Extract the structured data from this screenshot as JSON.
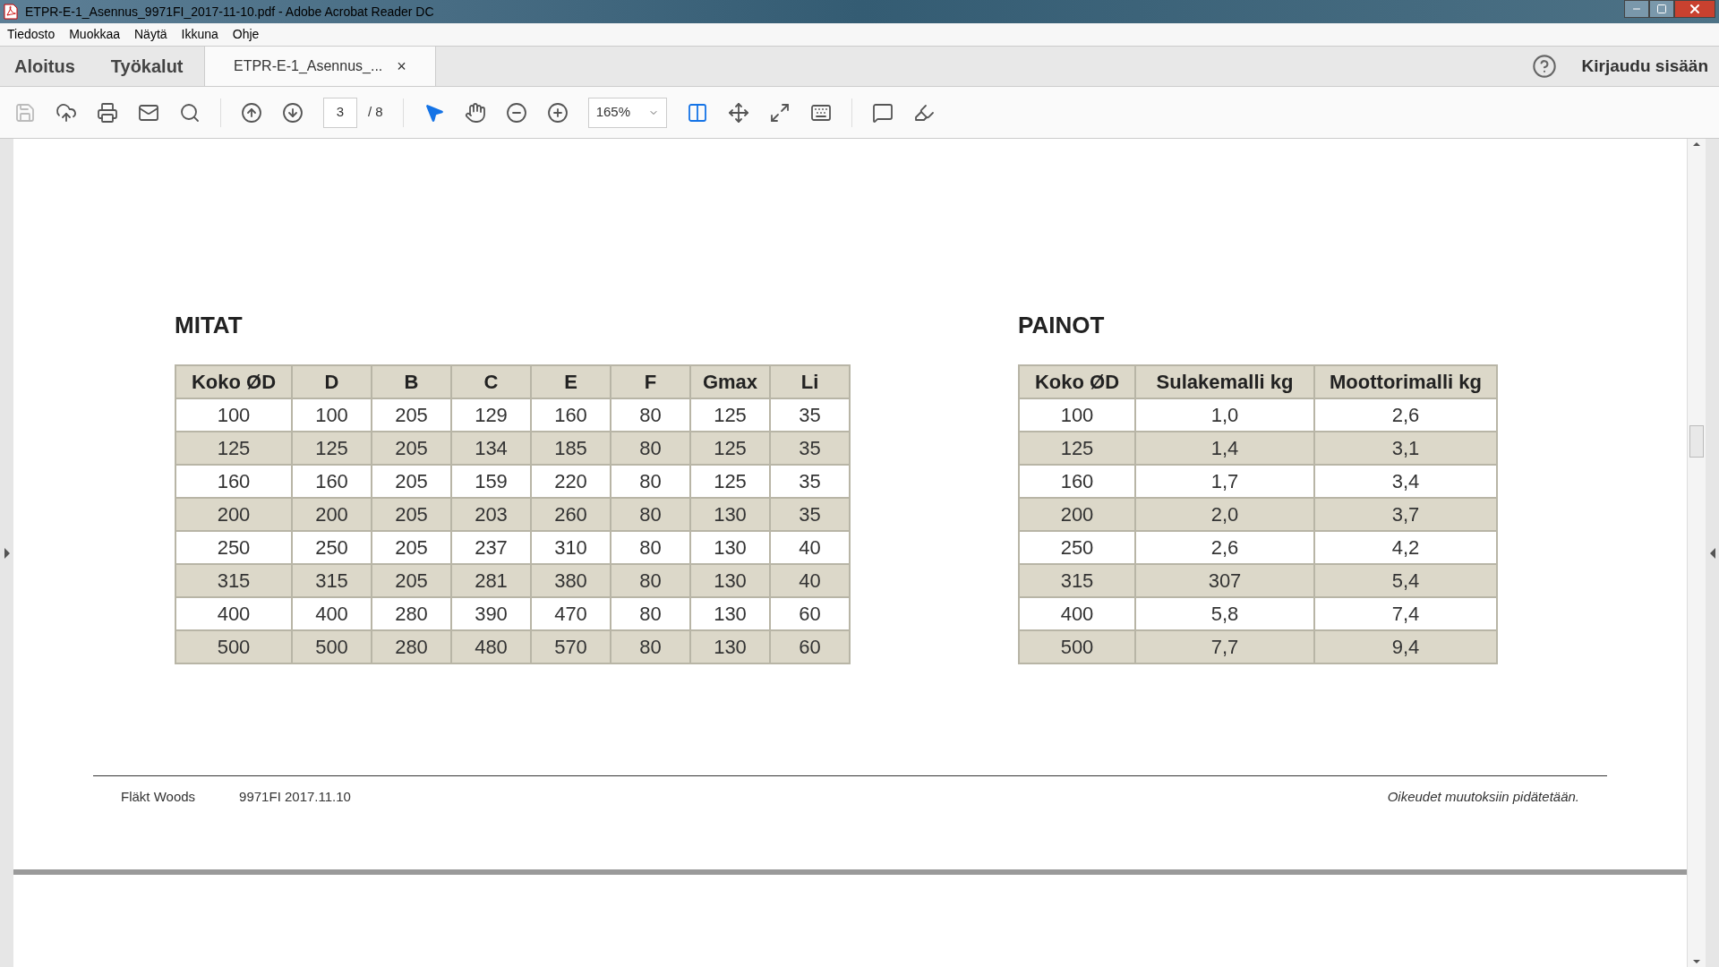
{
  "window": {
    "title": "ETPR-E-1_Asennus_9971FI_2017-11-10.pdf - Adobe Acrobat Reader DC"
  },
  "menu": [
    "Tiedosto",
    "Muokkaa",
    "Näytä",
    "Ikkuna",
    "Ohje"
  ],
  "nav": [
    {
      "label": "Aloitus",
      "selected": false
    },
    {
      "label": "Työkalut",
      "selected": false
    }
  ],
  "doc_tab": {
    "label": "ETPR-E-1_Asennus_...",
    "close": "×",
    "selected": true
  },
  "sign_in": "Kirjaudu sisään",
  "toolbar": {
    "page": "3",
    "page_total": "/ 8",
    "zoom": "165%"
  },
  "sections": [
    {
      "title": "MITAT",
      "columns": [
        "Koko ØD",
        "D",
        "B",
        "C",
        "E",
        "F",
        "Gmax",
        "Li"
      ],
      "rows": [
        [
          "100",
          "100",
          "205",
          "129",
          "160",
          "80",
          "125",
          "35"
        ],
        [
          "125",
          "125",
          "205",
          "134",
          "185",
          "80",
          "125",
          "35"
        ],
        [
          "160",
          "160",
          "205",
          "159",
          "220",
          "80",
          "125",
          "35"
        ],
        [
          "200",
          "200",
          "205",
          "203",
          "260",
          "80",
          "130",
          "35"
        ],
        [
          "250",
          "250",
          "205",
          "237",
          "310",
          "80",
          "130",
          "40"
        ],
        [
          "315",
          "315",
          "205",
          "281",
          "380",
          "80",
          "130",
          "40"
        ],
        [
          "400",
          "400",
          "280",
          "390",
          "470",
          "80",
          "130",
          "60"
        ],
        [
          "500",
          "500",
          "280",
          "480",
          "570",
          "80",
          "130",
          "60"
        ]
      ]
    },
    {
      "title": "PAINOT",
      "columns": [
        "Koko ØD",
        "Sulakemalli kg",
        "Moottorimalli kg"
      ],
      "rows": [
        [
          "100",
          "1,0",
          "2,6"
        ],
        [
          "125",
          "1,4",
          "3,1"
        ],
        [
          "160",
          "1,7",
          "3,4"
        ],
        [
          "200",
          "2,0",
          "3,7"
        ],
        [
          "250",
          "2,6",
          "4,2"
        ],
        [
          "315",
          "307",
          "5,4"
        ],
        [
          "400",
          "5,8",
          "7,4"
        ],
        [
          "500",
          "7,7",
          "9,4"
        ]
      ]
    }
  ],
  "footer": {
    "company": "Fläkt Woods",
    "code": "9971FI 2017.11.10",
    "notice": "Oikeudet muutoksiin pidätetään."
  }
}
